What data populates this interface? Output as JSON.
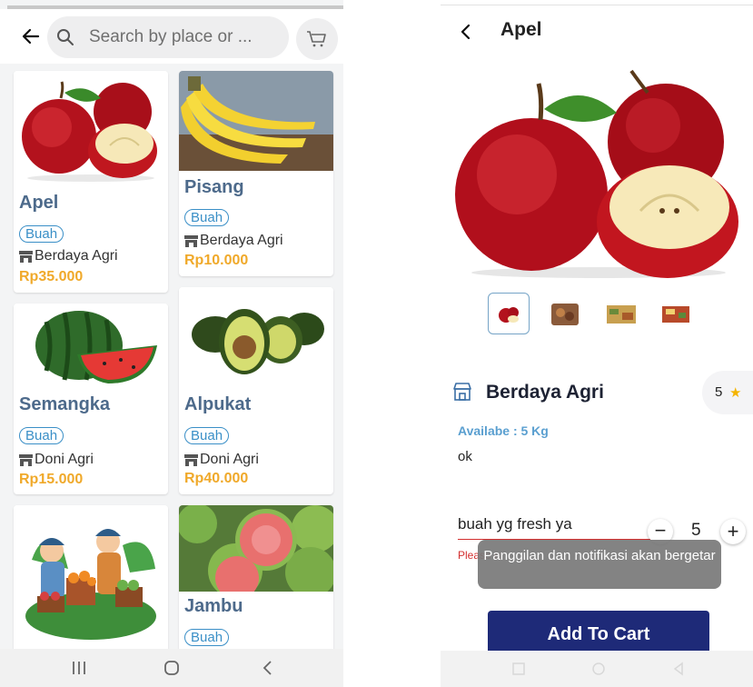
{
  "left": {
    "search": {
      "placeholder": "Search by place or ..."
    },
    "icons": {
      "back": "back-arrow-icon",
      "search": "search-icon",
      "cart": "cart-icon"
    },
    "products": [
      {
        "name": "Apel",
        "category": "Buah",
        "store": "Berdaya Agri",
        "price": "Rp35.000"
      },
      {
        "name": "Pisang",
        "category": "Buah",
        "store": "Berdaya Agri",
        "price": "Rp10.000"
      },
      {
        "name": "Semangka",
        "category": "Buah",
        "store": "Doni Agri",
        "price": "Rp15.000"
      },
      {
        "name": "Alpukat",
        "category": "Buah",
        "store": "Doni Agri",
        "price": "Rp40.000"
      },
      {
        "name": "",
        "category": "",
        "store": "",
        "price": ""
      },
      {
        "name": "Jambu",
        "category": "Buah",
        "store": "",
        "price": ""
      }
    ],
    "colors": {
      "name": "#4d6a8b",
      "badge": "#3a8fc7",
      "price": "#f0a92a"
    }
  },
  "right": {
    "title": "Apel",
    "store_name": "Berdaya Agri",
    "rating": "5",
    "availability": "Availabe : 5 Kg",
    "description": "ok",
    "note_value": "buah yg fresh ya",
    "quantity": "5",
    "error_text": "Please er",
    "toast_text": "Panggilan dan notifikasi akan bergetar",
    "add_to_cart": "Add To Cart",
    "colors": {
      "button": "#1e2a78",
      "availability": "#5a9fd0",
      "error": "#d32f2f"
    }
  }
}
